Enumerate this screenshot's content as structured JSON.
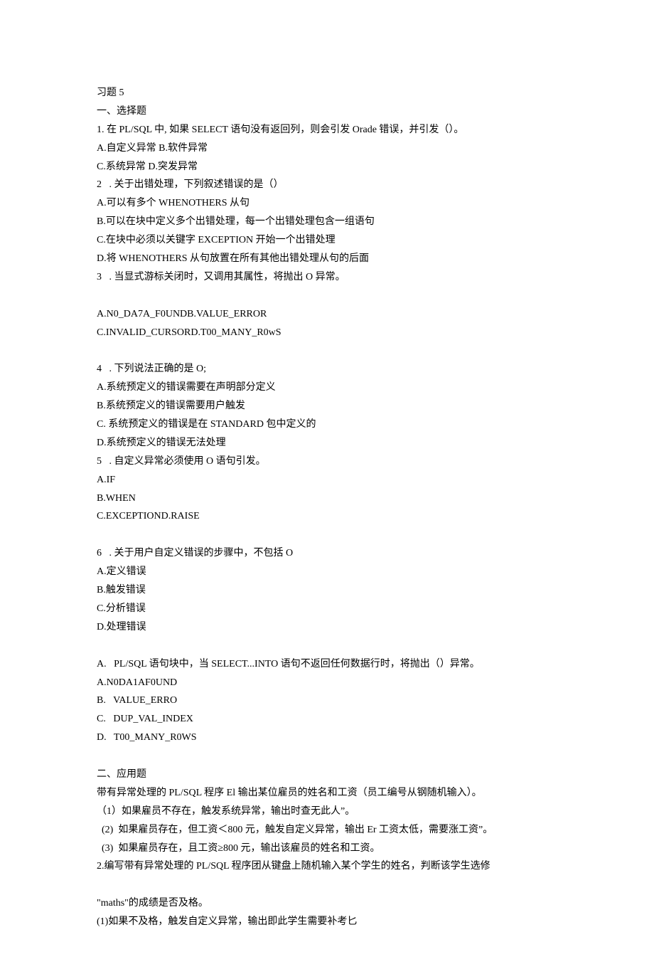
{
  "lines": [
    "习题 5",
    "一、选择题",
    "1. 在 PL/SQL 中, 如果 SELECT 语句没有返回列，则会引发 Orade 错误，并引发（）。",
    "A.自定义异常 B.软件异常",
    "C.系统异常 D.突发异常",
    "2   . 关于出错处理，下列叙述错误的是（）",
    "A.可以有多个 WHENOTHERS 从句",
    "B.可以在块中定义多个出错处理，每一个出错处理包含一组语句",
    "C.在块中必须以关键字 EXCEPTION 开始一个出错处理",
    "D.将 WHENOTHERS 从句放置在所有其他出错处理从句的后面",
    "3   . 当显式游标关闭时，又调用其属性，将抛出 O 异常。",
    "",
    "A.N0_DA7A_F0UNDB.VALUE_ERROR",
    "C.INVALID_CURSORD.T00_MANY_R0wS",
    "",
    "4   . 下列说法正确的是 O;",
    "A.系统预定义的错误需要在声明部分定义",
    "B.系统预定义的错误需要用户触发",
    "C. 系统预定义的错误是在 STANDARD 包中定义的",
    "D.系统预定义的错误无法处理",
    "5   . 自定义异常必须使用 O 语句引发。",
    "A.IF",
    "B.WHEN",
    "C.EXCEPTIOND.RAISE",
    "",
    "6   . 关于用户自定义错误的步骤中，不包括 O",
    "A.定义错误",
    "B.触发错误",
    "C.分析错误",
    "D.处理错误",
    "",
    "A.   PL/SQL 语句块中，当 SELECT...INTO 语句不返回任何数据行时，将抛出（）异常。",
    "A.N0DA1AF0UND",
    "B.   VALUE_ERRO",
    "C.   DUP_VAL_INDEX",
    "D.   T00_MANY_R0WS",
    "",
    "二、应用题",
    "带有异常处理的 PL/SQL 程序 El 输出某位雇员的姓名和工资（员工编号从钢随机输入）。",
    "（1）如果雇员不存在，触发系统异常，输出时查无此人”。",
    "  (2)  如果雇员存在，但工资＜800 元，触发自定义异常，输出 Er 工资太低，需要涨工资”。",
    "  (3)  如果雇员存在，且工资≥800 元，输出该雇员的姓名和工资。",
    "2.编写带有异常处理的 PL/SQL 程序团从键盘上随机输入某个学生的姓名，判断该学生选修",
    "",
    "\"maths\"的成绩是否及格。",
    "(1)如果不及格，触发自定义异常，输出即此学生需要补考匕"
  ]
}
